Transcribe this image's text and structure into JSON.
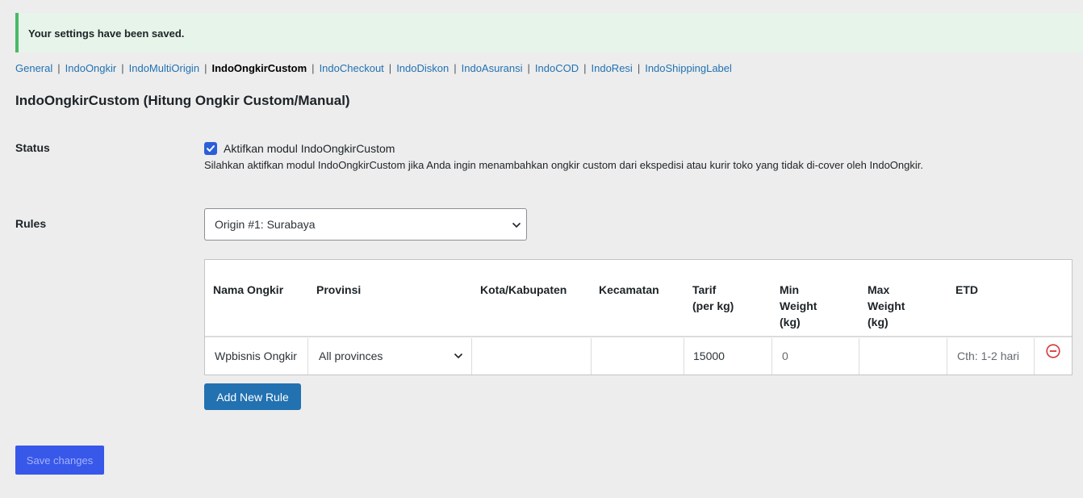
{
  "notice": {
    "text": "Your settings have been saved."
  },
  "subnav": [
    {
      "label": "General",
      "current": false
    },
    {
      "label": "IndoOngkir",
      "current": false
    },
    {
      "label": "IndoMultiOrigin",
      "current": false
    },
    {
      "label": "IndoOngkirCustom",
      "current": true
    },
    {
      "label": "IndoCheckout",
      "current": false
    },
    {
      "label": "IndoDiskon",
      "current": false
    },
    {
      "label": "IndoAsuransi",
      "current": false
    },
    {
      "label": "IndoCOD",
      "current": false
    },
    {
      "label": "IndoResi",
      "current": false
    },
    {
      "label": "IndoShippingLabel",
      "current": false
    }
  ],
  "separator": "|",
  "page": {
    "title": "IndoOngkirCustom (Hitung Ongkir Custom/Manual)"
  },
  "status": {
    "label": "Status",
    "checkbox_checked": true,
    "checkbox_label": "Aktifkan modul IndoOngkirCustom",
    "description": "Silahkan aktifkan modul IndoOngkirCustom jika Anda ingin menambahkan ongkir custom dari ekspedisi atau kurir toko yang tidak di-cover oleh IndoOngkir."
  },
  "rules": {
    "label": "Rules",
    "origin_select": "Origin #1: Surabaya",
    "table": {
      "headers": [
        [
          "Nama Ongkir"
        ],
        [
          "Provinsi"
        ],
        [
          "Kota/Kabupaten"
        ],
        [
          "Kecamatan"
        ],
        [
          "Tarif",
          "(per kg)"
        ],
        [
          "Min",
          "Weight",
          "(kg)"
        ],
        [
          "Max",
          "Weight",
          "(kg)"
        ],
        [
          "ETD"
        ]
      ],
      "row": {
        "nama_ongkir": "Wpbisnis Ongkir",
        "provinsi": "All provinces",
        "kota": "",
        "kecamatan": "",
        "tarif": "15000",
        "min_weight": "0",
        "max_weight": "",
        "etd_placeholder": "Cth: 1-2 hari"
      }
    },
    "add_button": "Add New Rule"
  },
  "save_button": "Save changes",
  "colors": {
    "primary": "#2271b1",
    "save": "#3858e9",
    "remove": "#d63638",
    "notice_border": "#4ab866"
  },
  "icons": {
    "checkbox": "checkmark-icon",
    "dropdown": "chevron-down-icon",
    "remove": "remove-circle-icon"
  }
}
